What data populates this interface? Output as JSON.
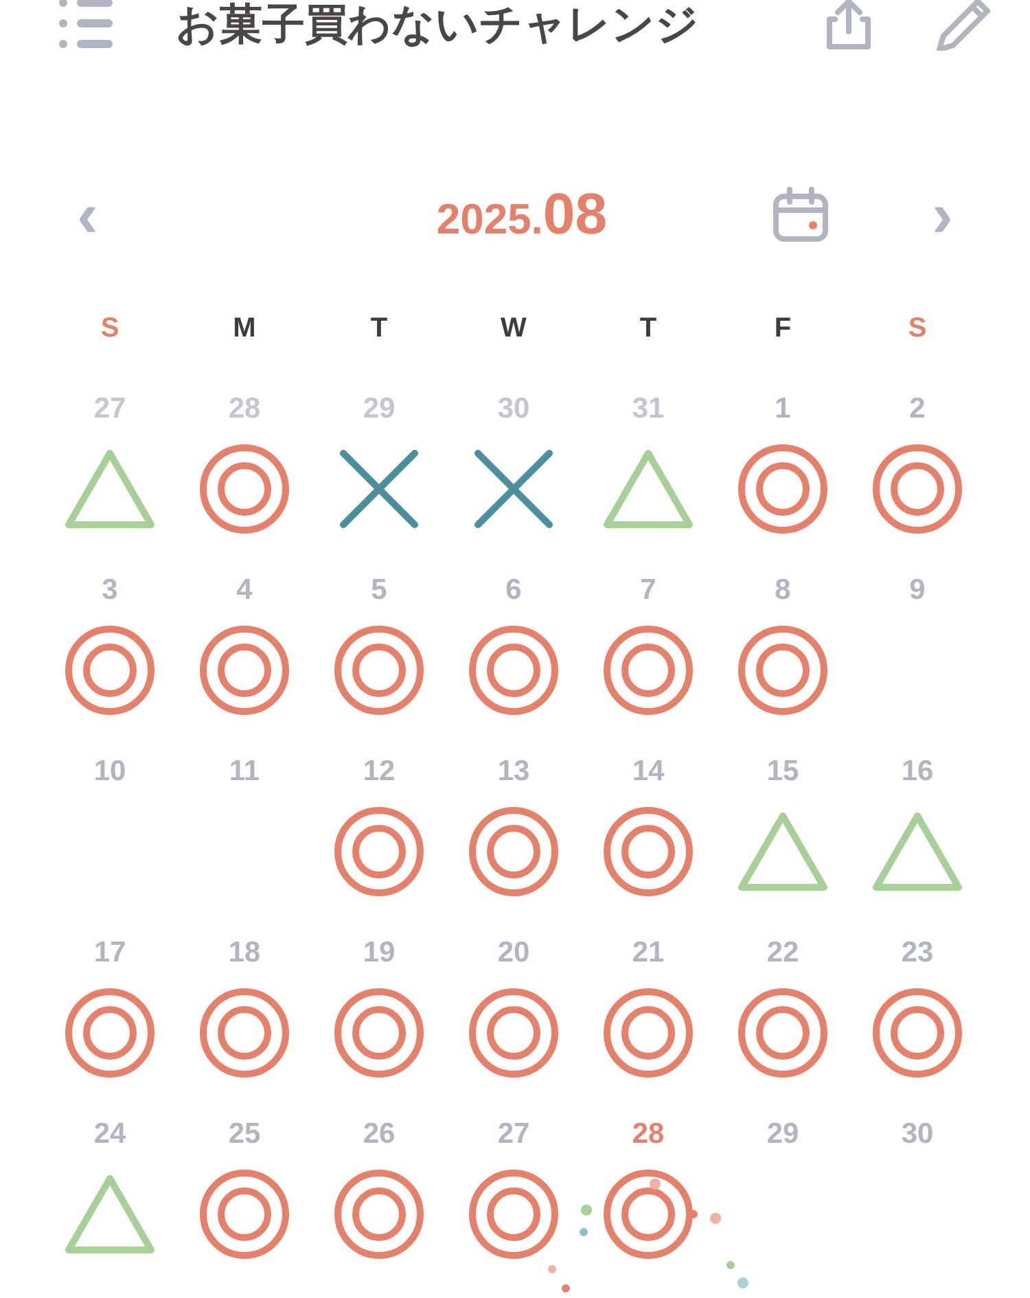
{
  "header": {
    "title": "お菓子買わないチャレンジ"
  },
  "month_nav": {
    "prev": "‹",
    "year": "2025.",
    "month": "08",
    "next": "›"
  },
  "weekdays": [
    {
      "label": "S",
      "weekend": true
    },
    {
      "label": "M",
      "weekend": false
    },
    {
      "label": "T",
      "weekend": false
    },
    {
      "label": "W",
      "weekend": false
    },
    {
      "label": "T",
      "weekend": false
    },
    {
      "label": "F",
      "weekend": false
    },
    {
      "label": "S",
      "weekend": true
    }
  ],
  "days": [
    {
      "day": "27",
      "other_month": true,
      "today": false,
      "kind": "triangle"
    },
    {
      "day": "28",
      "other_month": true,
      "today": false,
      "kind": "double-circle"
    },
    {
      "day": "29",
      "other_month": true,
      "today": false,
      "kind": "cross"
    },
    {
      "day": "30",
      "other_month": true,
      "today": false,
      "kind": "cross"
    },
    {
      "day": "31",
      "other_month": true,
      "today": false,
      "kind": "triangle"
    },
    {
      "day": "1",
      "other_month": false,
      "today": false,
      "kind": "double-circle"
    },
    {
      "day": "2",
      "other_month": false,
      "today": false,
      "kind": "double-circle"
    },
    {
      "day": "3",
      "other_month": false,
      "today": false,
      "kind": "double-circle"
    },
    {
      "day": "4",
      "other_month": false,
      "today": false,
      "kind": "double-circle"
    },
    {
      "day": "5",
      "other_month": false,
      "today": false,
      "kind": "double-circle"
    },
    {
      "day": "6",
      "other_month": false,
      "today": false,
      "kind": "double-circle"
    },
    {
      "day": "7",
      "other_month": false,
      "today": false,
      "kind": "double-circle"
    },
    {
      "day": "8",
      "other_month": false,
      "today": false,
      "kind": "double-circle"
    },
    {
      "day": "9",
      "other_month": false,
      "today": false,
      "kind": "blank"
    },
    {
      "day": "10",
      "other_month": false,
      "today": false,
      "kind": "blank"
    },
    {
      "day": "11",
      "other_month": false,
      "today": false,
      "kind": "blank"
    },
    {
      "day": "12",
      "other_month": false,
      "today": false,
      "kind": "double-circle"
    },
    {
      "day": "13",
      "other_month": false,
      "today": false,
      "kind": "double-circle"
    },
    {
      "day": "14",
      "other_month": false,
      "today": false,
      "kind": "double-circle"
    },
    {
      "day": "15",
      "other_month": false,
      "today": false,
      "kind": "triangle"
    },
    {
      "day": "16",
      "other_month": false,
      "today": false,
      "kind": "triangle"
    },
    {
      "day": "17",
      "other_month": false,
      "today": false,
      "kind": "double-circle"
    },
    {
      "day": "18",
      "other_month": false,
      "today": false,
      "kind": "double-circle"
    },
    {
      "day": "19",
      "other_month": false,
      "today": false,
      "kind": "double-circle"
    },
    {
      "day": "20",
      "other_month": false,
      "today": false,
      "kind": "double-circle"
    },
    {
      "day": "21",
      "other_month": false,
      "today": false,
      "kind": "double-circle"
    },
    {
      "day": "22",
      "other_month": false,
      "today": false,
      "kind": "double-circle"
    },
    {
      "day": "23",
      "other_month": false,
      "today": false,
      "kind": "double-circle"
    },
    {
      "day": "24",
      "other_month": false,
      "today": false,
      "kind": "triangle"
    },
    {
      "day": "25",
      "other_month": false,
      "today": false,
      "kind": "double-circle"
    },
    {
      "day": "26",
      "other_month": false,
      "today": false,
      "kind": "double-circle"
    },
    {
      "day": "27",
      "other_month": false,
      "today": false,
      "kind": "double-circle"
    },
    {
      "day": "28",
      "other_month": false,
      "today": true,
      "kind": "double-circle"
    },
    {
      "day": "29",
      "other_month": false,
      "today": false,
      "kind": "blank"
    },
    {
      "day": "30",
      "other_month": false,
      "today": false,
      "kind": "blank"
    }
  ]
}
